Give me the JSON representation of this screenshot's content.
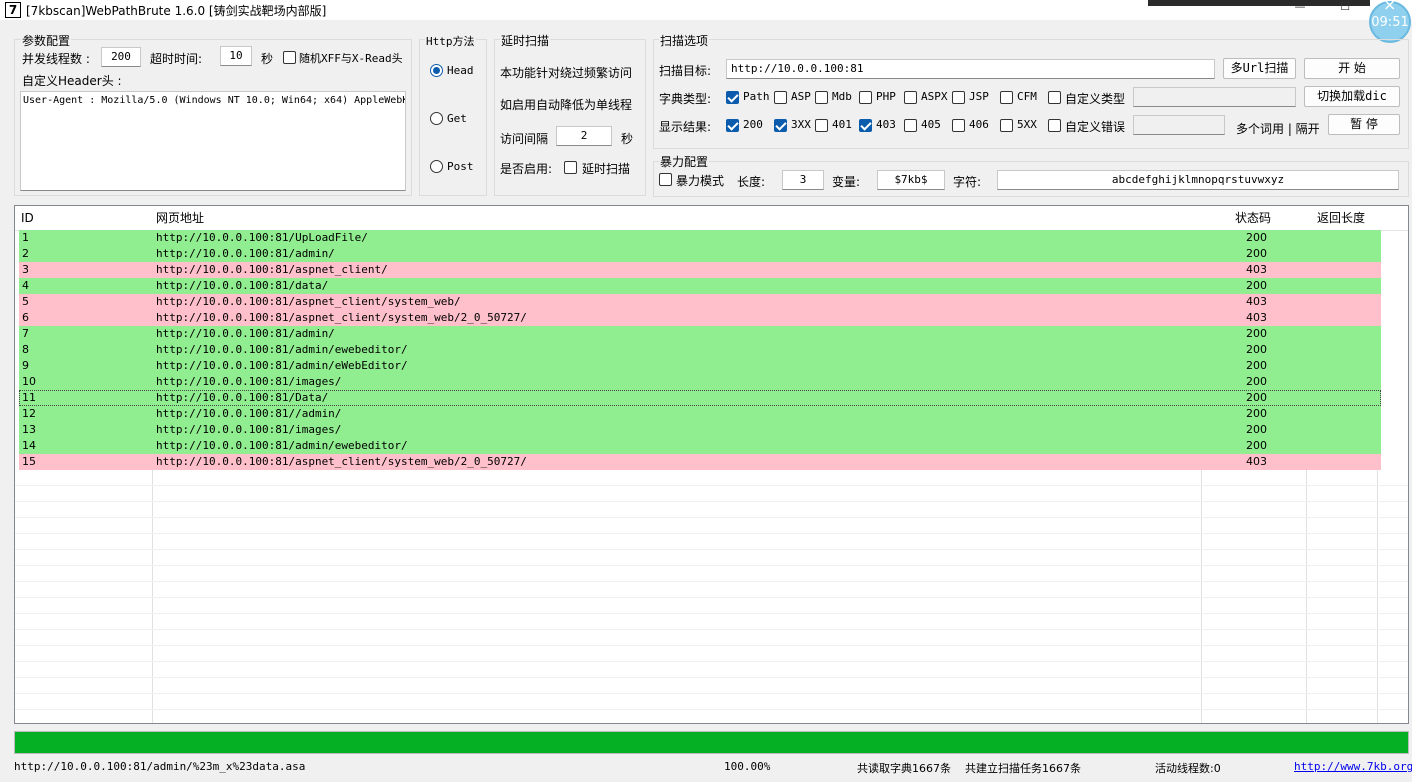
{
  "window": {
    "app_icon": "7",
    "title": "[7kbscan]WebPathBrute 1.6.0 [铸剑实战靶场内部版]",
    "minimize": "—",
    "maximize": "☐",
    "clock": "09:51",
    "clock_close": "×"
  },
  "params": {
    "group_label": "参数配置",
    "threads_label": "并发线程数 :",
    "threads_value": "200",
    "timeout_label": "超时时间:",
    "timeout_value": "10",
    "timeout_unit": "秒",
    "xff_label": "随机XFF与X-Read头",
    "xff_checked": false,
    "header_label": "自定义Header头 :",
    "header_value": "User-Agent : Mozilla/5.0 (Windows NT 10.0; Win64; x64) AppleWebK"
  },
  "http_method": {
    "group_label": "Http方法",
    "options": [
      {
        "label": "Head",
        "checked": true
      },
      {
        "label": "Get",
        "checked": false
      },
      {
        "label": "Post",
        "checked": false
      }
    ]
  },
  "delay": {
    "group_label": "延时扫描",
    "desc1": "本功能针对绕过频繁访问",
    "desc2": "如启用自动降低为单线程",
    "interval_label": "访问间隔",
    "interval_value": "2",
    "interval_unit": "秒",
    "enable_label": "是否启用:",
    "enable_checkbox_label": "延时扫描",
    "enable_checked": false
  },
  "scan_options": {
    "group_label": "扫描选项",
    "target_label": "扫描目标:",
    "target_value": "http://10.0.0.100:81",
    "multi_url_button": "多Url扫描",
    "start_button": "开 始",
    "dict_label": "字典类型:",
    "dict_types": [
      {
        "label": "Path",
        "checked": true
      },
      {
        "label": "ASP",
        "checked": false
      },
      {
        "label": "Mdb",
        "checked": false
      },
      {
        "label": "PHP",
        "checked": false
      },
      {
        "label": "ASPX",
        "checked": false
      },
      {
        "label": "JSP",
        "checked": false
      },
      {
        "label": "CFM",
        "checked": false
      }
    ],
    "custom_type_label": "自定义类型",
    "custom_type_checked": false,
    "custom_type_value": "",
    "switch_dic_button": "切换加载dic",
    "result_label": "显示结果:",
    "result_codes": [
      {
        "label": "200",
        "checked": true
      },
      {
        "label": "3XX",
        "checked": true
      },
      {
        "label": "401",
        "checked": false
      },
      {
        "label": "403",
        "checked": true
      },
      {
        "label": "405",
        "checked": false
      },
      {
        "label": "406",
        "checked": false
      },
      {
        "label": "5XX",
        "checked": false
      }
    ],
    "custom_error_label": "自定义错误",
    "custom_error_checked": false,
    "custom_error_value": "",
    "multi_word_hint": "多个词用 | 隔开",
    "pause_button": "暂 停"
  },
  "brute": {
    "group_label": "暴力配置",
    "mode_label": "暴力模式",
    "mode_checked": false,
    "length_label": "长度:",
    "length_value": "3",
    "variable_label": "变量:",
    "variable_value": "$7kb$",
    "chars_label": "字符:",
    "chars_value": "abcdefghijklmnopqrstuvwxyz"
  },
  "table": {
    "headers": {
      "id": "ID",
      "url": "网页地址",
      "status": "状态码",
      "length": "返回长度"
    },
    "rows": [
      {
        "id": "1",
        "url": "http://10.0.0.100:81/UpLoadFile/",
        "status": "200",
        "length": "",
        "color": "#90ee90"
      },
      {
        "id": "2",
        "url": "http://10.0.0.100:81/admin/",
        "status": "200",
        "length": "",
        "color": "#90ee90"
      },
      {
        "id": "3",
        "url": "http://10.0.0.100:81/aspnet_client/",
        "status": "403",
        "length": "",
        "color": "#ffc0cb"
      },
      {
        "id": "4",
        "url": "http://10.0.0.100:81/data/",
        "status": "200",
        "length": "",
        "color": "#90ee90"
      },
      {
        "id": "5",
        "url": "http://10.0.0.100:81/aspnet_client/system_web/",
        "status": "403",
        "length": "",
        "color": "#ffc0cb"
      },
      {
        "id": "6",
        "url": "http://10.0.0.100:81/aspnet_client/system_web/2_0_50727/",
        "status": "403",
        "length": "",
        "color": "#ffc0cb"
      },
      {
        "id": "7",
        "url": "http://10.0.0.100:81/admin/",
        "status": "200",
        "length": "",
        "color": "#90ee90"
      },
      {
        "id": "8",
        "url": "http://10.0.0.100:81/admin/ewebeditor/",
        "status": "200",
        "length": "",
        "color": "#90ee90"
      },
      {
        "id": "9",
        "url": "http://10.0.0.100:81/admin/eWebEditor/",
        "status": "200",
        "length": "",
        "color": "#90ee90"
      },
      {
        "id": "10",
        "url": "http://10.0.0.100:81/images/",
        "status": "200",
        "length": "",
        "color": "#90ee90"
      },
      {
        "id": "11",
        "url": "http://10.0.0.100:81/Data/",
        "status": "200",
        "length": "",
        "color": "#90ee90",
        "focused": true
      },
      {
        "id": "12",
        "url": "http://10.0.0.100:81//admin/",
        "status": "200",
        "length": "",
        "color": "#90ee90"
      },
      {
        "id": "13",
        "url": "http://10.0.0.100:81/images/",
        "status": "200",
        "length": "",
        "color": "#90ee90"
      },
      {
        "id": "14",
        "url": "http://10.0.0.100:81/admin/ewebeditor/",
        "status": "200",
        "length": "",
        "color": "#90ee90"
      },
      {
        "id": "15",
        "url": "http://10.0.0.100:81/aspnet_client/system_web/2_0_50727/",
        "status": "403",
        "length": "",
        "color": "#ffc0cb"
      }
    ]
  },
  "progress": {
    "fraction": 1.0,
    "color": "#06b025"
  },
  "status_bar": {
    "current_url": "http://10.0.0.100:81/admin/%23m_x%23data.asa",
    "percent": "100.00%",
    "dict_count": "共读取字典1667条",
    "task_count": "共建立扫描任务1667条",
    "active_threads": "活动线程数:0",
    "link": "http://www.7kb.org"
  }
}
